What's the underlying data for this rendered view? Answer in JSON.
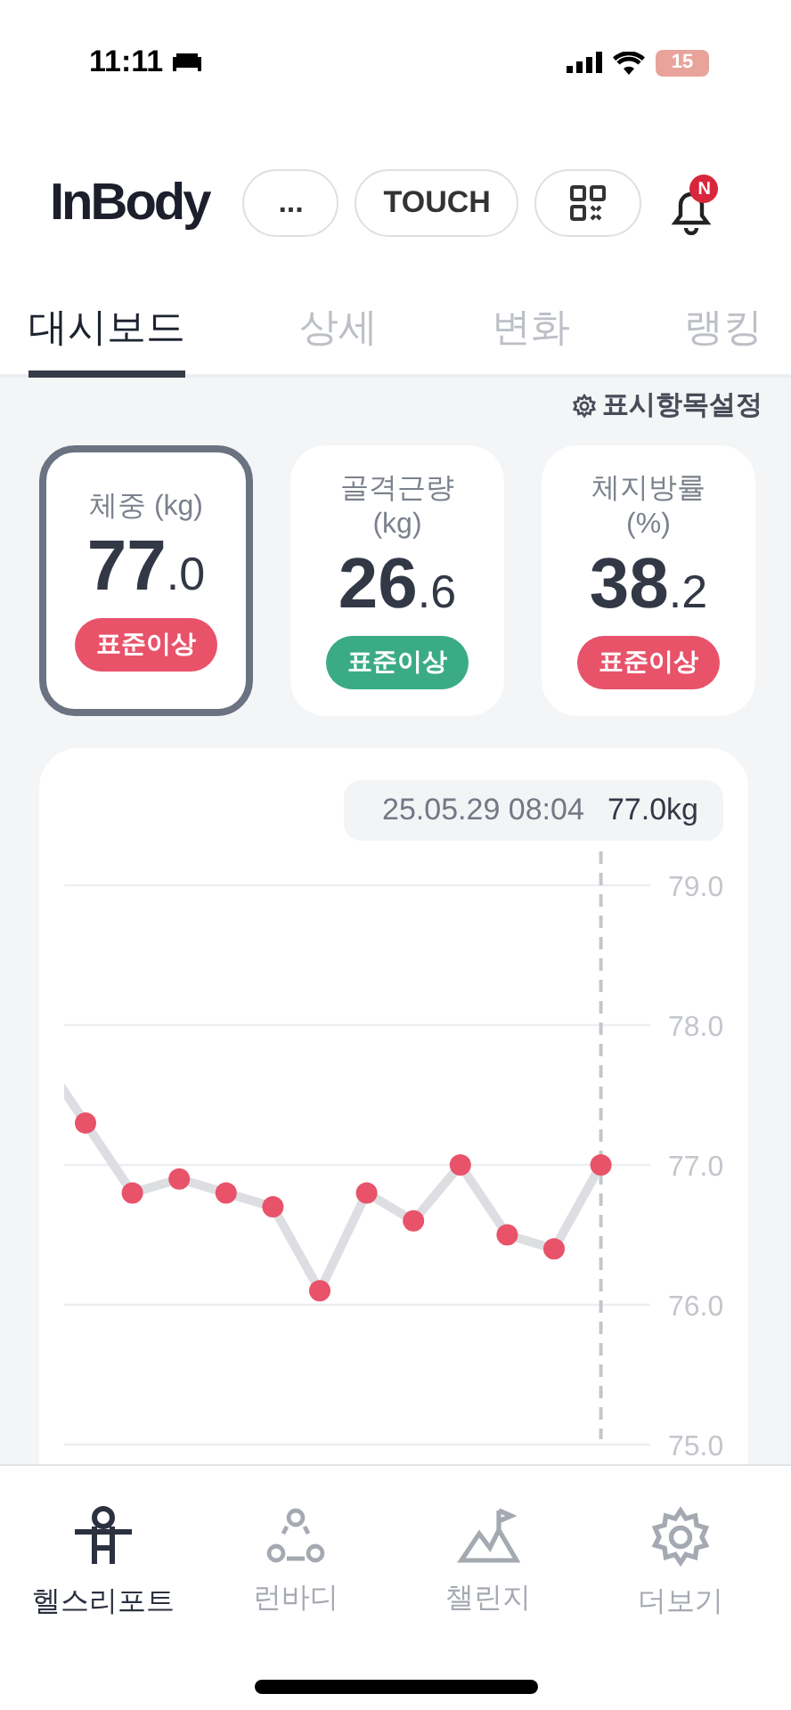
{
  "status_bar": {
    "time": "11:11",
    "battery": "15"
  },
  "header": {
    "logo": "InBody",
    "buttons": [
      "...",
      "TOUCH"
    ],
    "notification_badge": "N"
  },
  "tabs": [
    {
      "label": "대시보드",
      "selected": true
    },
    {
      "label": "상세",
      "selected": false
    },
    {
      "label": "변화",
      "selected": false
    },
    {
      "label": "랭킹",
      "selected": false
    }
  ],
  "settings_link": "표시항목설정",
  "metrics": [
    {
      "label": "체중 (kg)",
      "whole": "77",
      "decimal": ".0",
      "status": "표준이상",
      "color": "#e8536a",
      "selected": true
    },
    {
      "label": "골격근량\n(kg)",
      "whole": "26",
      "decimal": ".6",
      "status": "표준이상",
      "color": "#3bab86",
      "selected": false
    },
    {
      "label": "체지방률\n(%)",
      "whole": "38",
      "decimal": ".2",
      "status": "표준이상",
      "color": "#e8536a",
      "selected": false
    }
  ],
  "chart": {
    "tooltip_date": "25.05.29 08:04",
    "tooltip_value": "77.0kg",
    "chart_data": {
      "type": "line",
      "grid": true,
      "ylim": [
        75,
        79
      ],
      "yticks": [
        {
          "value": 79,
          "label": "79.0"
        },
        {
          "value": 78,
          "label": "78.0"
        },
        {
          "value": 77,
          "label": "77.0"
        },
        {
          "value": 76,
          "label": "76.0"
        },
        {
          "value": 75,
          "label": "75.0"
        }
      ],
      "series": [
        {
          "color": "#e8536a",
          "marker": true,
          "values": [
            77.3,
            76.8,
            76.9,
            76.8,
            76.7,
            76.1,
            76.8,
            76.6,
            77.0,
            76.5,
            76.4,
            77.0
          ]
        }
      ]
    }
  },
  "bottom_nav": [
    {
      "label": "헬스리포트",
      "selected": true
    },
    {
      "label": "런바디",
      "selected": false
    },
    {
      "label": "챌린지",
      "selected": false
    },
    {
      "label": "더보기",
      "selected": false
    }
  ]
}
